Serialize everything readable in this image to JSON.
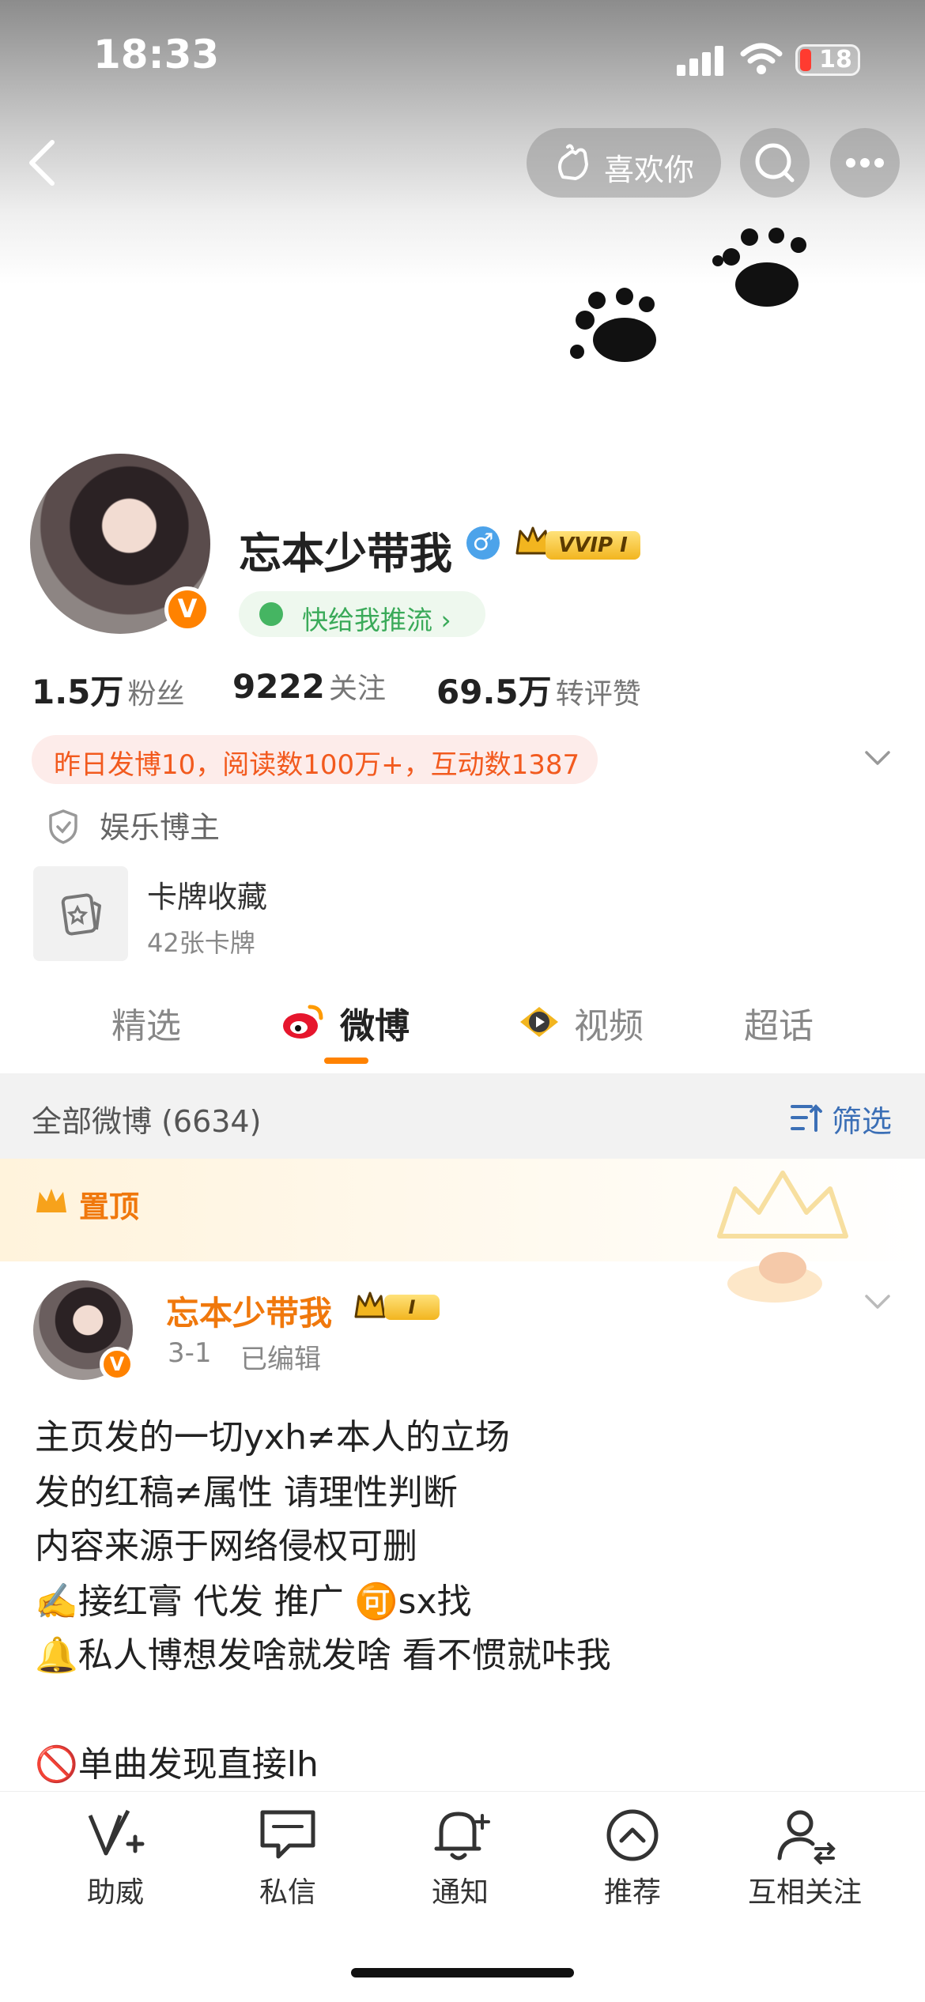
{
  "status_bar": {
    "time": "18:33",
    "battery": "18"
  },
  "header": {
    "like_label": "喜欢你"
  },
  "profile": {
    "name": "忘本少带我",
    "vip_label": "VVIP I",
    "push_label": "快给我推流 ›",
    "stats": [
      {
        "value": "1.5万",
        "label": "粉丝"
      },
      {
        "value": "9222",
        "label": "关注"
      },
      {
        "value": "69.5万",
        "label": "转评赞"
      }
    ],
    "info_banner": "昨日发博10，阅读数100万+，互动数1387",
    "tag": "娱乐博主",
    "card_title": "卡牌收藏",
    "card_count": "42张卡牌"
  },
  "tabs": [
    {
      "label": "精选",
      "active": false
    },
    {
      "label": "微博",
      "active": true
    },
    {
      "label": "视频",
      "active": false
    },
    {
      "label": "超话",
      "active": false
    }
  ],
  "feed": {
    "all_label": "全部微博 (6634)",
    "filter_label": "筛选",
    "pinned_label": "置顶"
  },
  "post": {
    "author": "忘本少带我",
    "vip_label": "I",
    "date": "3-1",
    "edited": "已编辑",
    "lines": [
      "主页发的一切yxh≠本人的立场",
      "发的红稿≠属性 请理性判断",
      " 内容来源于网络侵权可删",
      "✍️接红膏 代发 推广 🉑sx找",
      "🔔私人博想发啥就发啥 看不惯就咔我",
      "",
      "🚫单曲发现直接lh"
    ]
  },
  "bottom_nav": [
    {
      "label": "助威",
      "icon": "v-plus-icon"
    },
    {
      "label": "私信",
      "icon": "chat-bubble-icon"
    },
    {
      "label": "通知",
      "icon": "bell-plus-icon"
    },
    {
      "label": "推荐",
      "icon": "chevron-up-circle-icon"
    },
    {
      "label": "互相关注",
      "icon": "mutual-follow-icon"
    }
  ],
  "colors": {
    "accent": "#ff8200",
    "link_blue": "#3b6fb6",
    "banner_text": "#f25a1e",
    "green": "#3aaa59"
  }
}
